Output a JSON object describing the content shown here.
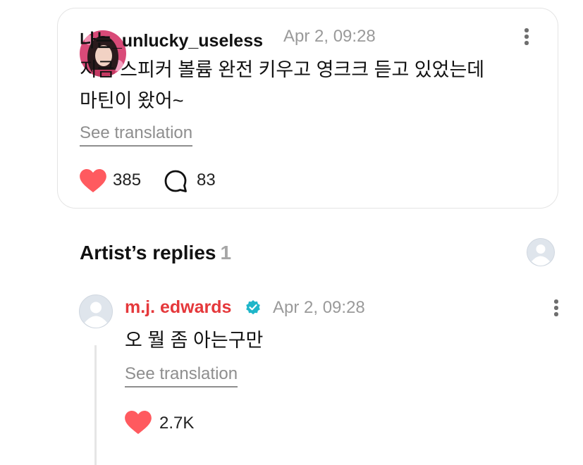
{
  "post": {
    "username": "나는_unlucky_useless",
    "timestamp": "Apr 2, 09:28",
    "text_line1": "지금 스피커 볼륨 완전 키우고 영크크 듣고 있었는데",
    "text_line2": "마틴이 왔어~",
    "translate_label": "See translation",
    "like_count": "385",
    "comment_count": "83"
  },
  "replies_section": {
    "title": "Artist’s replies",
    "count": "1"
  },
  "reply": {
    "username": "m.j. edwards",
    "timestamp": "Apr 2, 09:28",
    "text": "오 뭘 좀 아는구만",
    "translate_label": "See translation",
    "like_count": "2.7K"
  },
  "colors": {
    "heart": "#ff5a5f",
    "artist_name": "#e5383b",
    "verified_badge": "#1fb6c9",
    "muted_text": "#9a9a9a"
  },
  "icons": {
    "like": "heart-icon",
    "comment": "speech-bubble-icon",
    "more": "more-vertical-icon",
    "verified": "verified-badge-icon"
  }
}
